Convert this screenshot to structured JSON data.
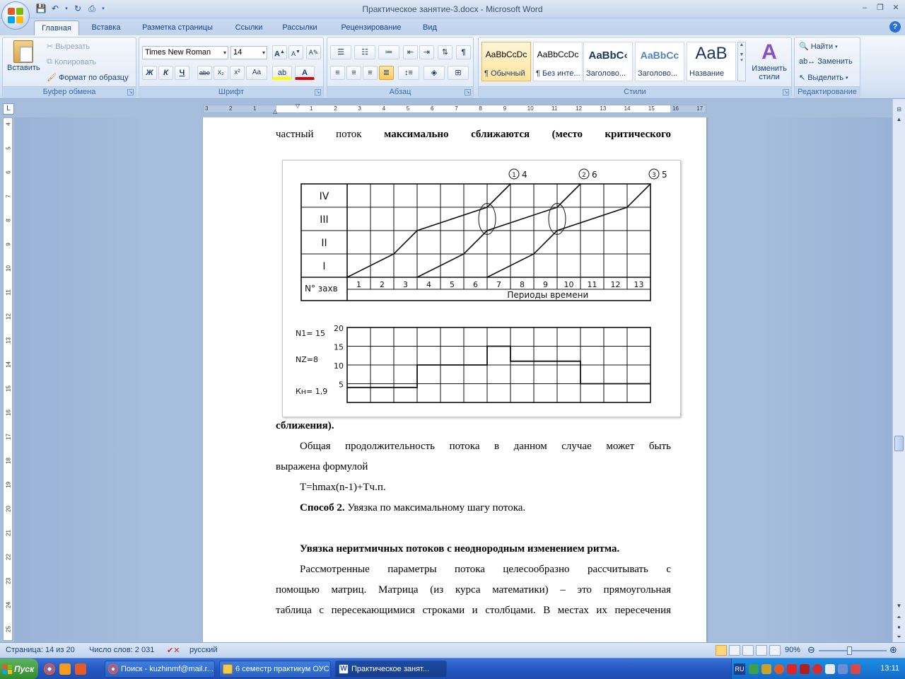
{
  "window": {
    "title": "Практическое занятие-3.docx - Microsoft Word"
  },
  "tabs": [
    "Главная",
    "Вставка",
    "Разметка страницы",
    "Ссылки",
    "Рассылки",
    "Рецензирование",
    "Вид"
  ],
  "clipboard": {
    "paste": "Вставить",
    "cut": "Вырезать",
    "copy": "Копировать",
    "format_painter": "Формат по образцу",
    "label": "Буфер обмена"
  },
  "font": {
    "name": "Times New Roman",
    "size": "14",
    "label": "Шрифт",
    "buttons": [
      "Ж",
      "К",
      "Ч",
      "abe",
      "x₂",
      "x²",
      "Aa"
    ],
    "grow": "A",
    "shrink": "A"
  },
  "paragraph": {
    "label": "Абзац"
  },
  "styles": {
    "label": "Стили",
    "cards": [
      {
        "sample": "AaBbCcDc",
        "name": "¶ Обычный"
      },
      {
        "sample": "AaBbCcDc",
        "name": "¶ Без инте..."
      },
      {
        "sample": "AaBbC‹",
        "name": "Заголово..."
      },
      {
        "sample": "AaBbCc",
        "name": "Заголово..."
      },
      {
        "sample": "AaB",
        "name": "Название"
      }
    ],
    "change_styles": "Изменить стили"
  },
  "editing": {
    "label": "Редактирование",
    "find": "Найти",
    "replace": "Заменить",
    "select": "Выделить"
  },
  "ruler": {
    "h_ticks": [
      "3",
      "2",
      "1",
      "1",
      "2",
      "3",
      "4",
      "5",
      "6",
      "7",
      "8",
      "9",
      "10",
      "11",
      "12",
      "13",
      "14",
      "15",
      "16",
      "17"
    ],
    "v_ticks": [
      "4",
      "5",
      "6",
      "7",
      "8",
      "9",
      "10",
      "11",
      "12",
      "13",
      "14",
      "15",
      "16",
      "17",
      "18",
      "19",
      "20",
      "21",
      "22",
      "23",
      "24",
      "25"
    ]
  },
  "document": {
    "line1_a": "частный",
    "line1_b": "поток",
    "line1_c": "максимально сближаются (место критического",
    "after_fig": "сближения).",
    "p1_line1": "Общая продолжительность потока в данном случае может быть",
    "p1_line2": "выражена формулой",
    "formula": "T=hmax(n-1)+Тч.п.",
    "method_bold": "Способ 2.",
    "method_text": " Увязка по максимальному шагу потока.",
    "heading": "Увязка неритмичных потоков с неоднородным изменением ритма.",
    "p2_line1": "Рассмотренные параметры потока целесообразно рассчитывать с",
    "p2_line2": "помощью матриц. Матрица (из курса математики) – это прямоугольная",
    "p2_line3": "таблица с пересекающимися строками и столбцами. В местах их пересечения"
  },
  "figure": {
    "rows": [
      "IV",
      "III",
      "II",
      "I"
    ],
    "header_label": "N° захв",
    "periods": [
      "1",
      "2",
      "3",
      "4",
      "5",
      "6",
      "7",
      "8",
      "9",
      "10",
      "11",
      "12",
      "13"
    ],
    "periods_label": "Периоды времени",
    "stream_tags": [
      {
        "num": "1",
        "val": "4"
      },
      {
        "num": "2",
        "val": "6"
      },
      {
        "num": "3",
        "val": "5"
      }
    ],
    "n1": "N1= 15",
    "n2": "NZ=8",
    "kn": "Кн= 1,9",
    "y_ticks": [
      "20",
      "15",
      "10",
      "5"
    ],
    "load_profile": [
      4,
      4,
      4,
      10,
      10,
      10,
      15,
      11,
      11,
      11,
      5,
      5,
      5
    ]
  },
  "status": {
    "page": "Страница: 14 из 20",
    "words": "Число слов: 2 031",
    "lang": "русский",
    "zoom": "90%"
  },
  "taskbar": {
    "start": "Пуск",
    "items": [
      "Поиск - kuzhinmf@mail.r...",
      "6 семестр практикум ОУС",
      "Практическое занят..."
    ],
    "lang": "RU",
    "clock": "13:11"
  }
}
